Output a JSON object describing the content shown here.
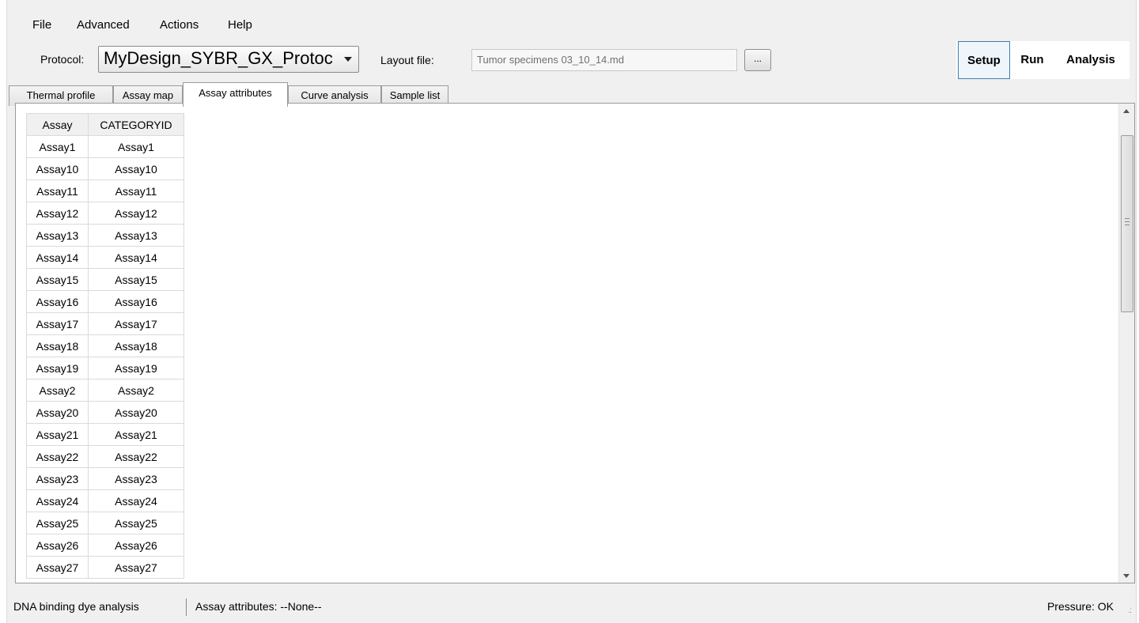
{
  "menu": [
    "File",
    "Advanced",
    "Actions",
    "Help"
  ],
  "toolbar": {
    "protocol_label": "Protocol:",
    "protocol_value": "MyDesign_SYBR_GX_Protoc",
    "layout_label": "Layout file:",
    "layout_value": "Tumor specimens 03_10_14.md",
    "browse_label": "..."
  },
  "modes": [
    {
      "label": "Setup",
      "active": true
    },
    {
      "label": "Run",
      "active": false
    },
    {
      "label": "Analysis",
      "active": false
    }
  ],
  "tabs": [
    {
      "label": "Thermal profile",
      "active": false
    },
    {
      "label": "Assay map",
      "active": false
    },
    {
      "label": "Assay attributes",
      "active": true
    },
    {
      "label": "Curve analysis",
      "active": false
    },
    {
      "label": "Sample list",
      "active": false
    }
  ],
  "grid": {
    "headers": [
      "Assay",
      "CATEGORYID"
    ],
    "rows": [
      [
        "Assay1",
        "Assay1"
      ],
      [
        "Assay10",
        "Assay10"
      ],
      [
        "Assay11",
        "Assay11"
      ],
      [
        "Assay12",
        "Assay12"
      ],
      [
        "Assay13",
        "Assay13"
      ],
      [
        "Assay14",
        "Assay14"
      ],
      [
        "Assay15",
        "Assay15"
      ],
      [
        "Assay16",
        "Assay16"
      ],
      [
        "Assay17",
        "Assay17"
      ],
      [
        "Assay18",
        "Assay18"
      ],
      [
        "Assay19",
        "Assay19"
      ],
      [
        "Assay2",
        "Assay2"
      ],
      [
        "Assay20",
        "Assay20"
      ],
      [
        "Assay21",
        "Assay21"
      ],
      [
        "Assay22",
        "Assay22"
      ],
      [
        "Assay23",
        "Assay23"
      ],
      [
        "Assay24",
        "Assay24"
      ],
      [
        "Assay25",
        "Assay25"
      ],
      [
        "Assay26",
        "Assay26"
      ],
      [
        "Assay27",
        "Assay27"
      ]
    ]
  },
  "status": {
    "left": "DNA binding dye analysis",
    "middle": "Assay attributes: --None--",
    "right": "Pressure: OK"
  },
  "colors": {
    "active_mode_border": "#3c7fb1",
    "window_bg": "#f0f0f0"
  }
}
